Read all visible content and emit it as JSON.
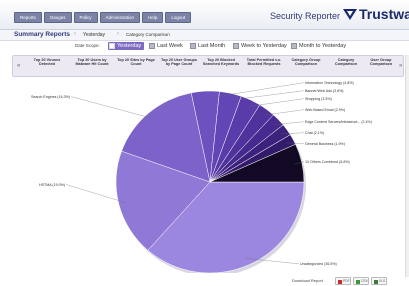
{
  "header": {
    "nav": [
      "Reports",
      "Gauges",
      "Policy",
      "Administration",
      "Help",
      "Logout"
    ],
    "app_title": "Security Reporter",
    "brand": "Trustwave"
  },
  "breadcrumb": {
    "main": "Summary Reports",
    "item1": "Yesterday",
    "item2": "Category Comparison"
  },
  "date_bar": {
    "scope_label": "Date Scope:",
    "buttons": [
      "Yesterday",
      "Last Week",
      "Last Month",
      "Week to Yesterday",
      "Month to Yesterday"
    ],
    "active": "Yesterday"
  },
  "tabs": [
    "Top 20 Viruses Detected",
    "Top 20 Users by Malware Hit Count",
    "Top 20 Sites by Page Count",
    "Top 20 User Groups by Page Count",
    "Top 20 Blocked Searched Keywords",
    "Total Permitted v.s. Blocked Requests",
    "Category Group Comparison",
    "Category Comparison",
    "User Group Comparison"
  ],
  "tab_scroll": {
    "left": "«",
    "right": "»"
  },
  "footer": {
    "download_label": "Download Report",
    "buttons": [
      {
        "name": "pdf",
        "label": "PDF",
        "color": "#cc2b2b"
      },
      {
        "name": "csv",
        "label": "CSV",
        "color": "#3a9a3a"
      },
      {
        "name": "xls",
        "label": "XLS",
        "color": "#3a7a3a"
      }
    ]
  },
  "colors": {
    "accent": "#7d6bc2",
    "header_text": "#2f3a79"
  },
  "chart_data": {
    "type": "pie",
    "title": "",
    "slices": [
      {
        "label": "Uncategorized",
        "value": 36.5,
        "color": "#9c87e0"
      },
      {
        "label": "HSTMA",
        "value": 19.0,
        "color": "#8f78d6"
      },
      {
        "label": "Search Engines",
        "value": 16.3,
        "color": "#7c62c9"
      },
      {
        "label": "Information Technology",
        "value": 4.8,
        "color": "#6d52bf"
      },
      {
        "label": "Banner/Web Ads",
        "value": 3.8,
        "color": "#6346b5"
      },
      {
        "label": "Shopping",
        "value": 3.5,
        "color": "#593ba9"
      },
      {
        "label": "Web Based Email",
        "value": 2.9,
        "color": "#50329c"
      },
      {
        "label": "Edge Content Servers/Infrastruct...",
        "value": 2.4,
        "color": "#462a8d"
      },
      {
        "label": "Chat",
        "value": 2.1,
        "color": "#3c227d"
      },
      {
        "label": "General Business",
        "value": 1.9,
        "color": "#331b6c"
      },
      {
        "label": "10 Others Combined",
        "value": 6.8,
        "color": "#120a24"
      }
    ],
    "labels": [
      "Uncategorized (36.5%)",
      "HSTMA (19.0%)",
      "Search Engines (16.3%)",
      "Information Technology (4.8%)",
      "Banner/Web Ads (3.8%)",
      "Shopping (3.5%)",
      "Web Based Email (2.9%)",
      "Edge Content Servers/Infrastruct... (2.4%)",
      "Chat (2.1%)",
      "General Business (1.9%)",
      "10 Others Combined (6.8%)"
    ]
  }
}
